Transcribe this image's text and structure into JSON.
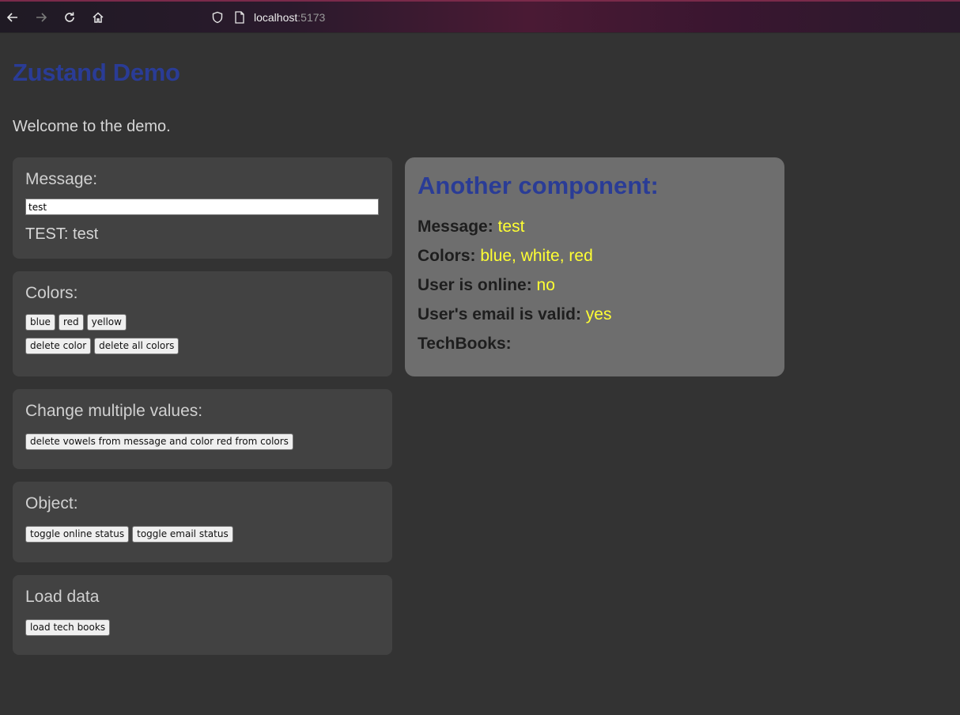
{
  "browser": {
    "url_host": "localhost",
    "url_port": ":5173"
  },
  "page": {
    "title": "Zustand Demo",
    "welcome": "Welcome to the demo."
  },
  "message_card": {
    "heading": "Message:",
    "input_value": "test",
    "test_prefix": "TEST:",
    "test_value": "test"
  },
  "colors_card": {
    "heading": "Colors:",
    "buttons": [
      "blue",
      "red",
      "yellow"
    ],
    "delete_color": "delete color",
    "delete_all_colors": "delete all colors"
  },
  "multi_card": {
    "heading": "Change multiple values:",
    "button": "delete vowels from message and color red from colors"
  },
  "object_card": {
    "heading": "Object:",
    "toggle_online": "toggle online status",
    "toggle_email": "toggle email status"
  },
  "load_card": {
    "heading": "Load data",
    "button": "load tech books"
  },
  "another_component": {
    "heading": "Another component:",
    "message_label": "Message:",
    "message_value": "test",
    "colors_label": "Colors:",
    "colors_value": "blue, white, red",
    "online_label": "User is online:",
    "online_value": "no",
    "email_label": "User's email is valid:",
    "email_value": "yes",
    "techbooks_label": "TechBooks:"
  },
  "colors": {
    "title_blue": "#2a3c96",
    "value_yellow": "#ffff33",
    "page_bg": "#333333",
    "card_bg": "#424242",
    "another_bg": "#6e6e6e"
  }
}
